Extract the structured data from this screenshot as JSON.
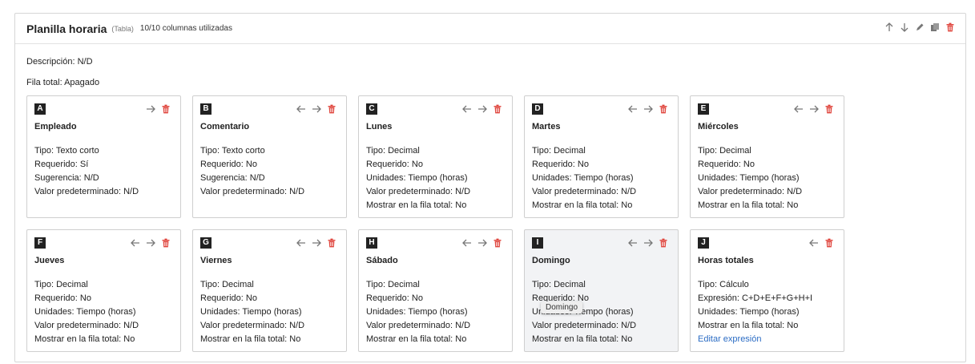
{
  "section": {
    "title": "Planilla horaria",
    "type": "(Tabla)",
    "usage": "10/10 columnas utilizadas",
    "description": "Descripción: N/D",
    "total_row": "Fila total: Apagado"
  },
  "cards": [
    {
      "letter": "A",
      "title": "Empleado",
      "lines": [
        "Tipo: Texto corto",
        "Requerido: Sí",
        "Sugerencia: N/D",
        "Valor predeterminado: N/D"
      ]
    },
    {
      "letter": "B",
      "title": "Comentario",
      "lines": [
        "Tipo: Texto corto",
        "Requerido: No",
        "Sugerencia: N/D",
        "Valor predeterminado: N/D"
      ]
    },
    {
      "letter": "C",
      "title": "Lunes",
      "lines": [
        "Tipo: Decimal",
        "Requerido: No",
        "Unidades: Tiempo (horas)",
        "Valor predeterminado: N/D",
        "Mostrar en la fila total: No"
      ]
    },
    {
      "letter": "D",
      "title": "Martes",
      "lines": [
        "Tipo: Decimal",
        "Requerido: No",
        "Unidades: Tiempo (horas)",
        "Valor predeterminado: N/D",
        "Mostrar en la fila total: No"
      ]
    },
    {
      "letter": "E",
      "title": "Miércoles",
      "lines": [
        "Tipo: Decimal",
        "Requerido: No",
        "Unidades: Tiempo (horas)",
        "Valor predeterminado: N/D",
        "Mostrar en la fila total: No"
      ]
    },
    {
      "letter": "F",
      "title": "Jueves",
      "lines": [
        "Tipo: Decimal",
        "Requerido: No",
        "Unidades: Tiempo (horas)",
        "Valor predeterminado: N/D",
        "Mostrar en la fila total: No"
      ]
    },
    {
      "letter": "G",
      "title": "Viernes",
      "lines": [
        "Tipo: Decimal",
        "Requerido: No",
        "Unidades: Tiempo (horas)",
        "Valor predeterminado: N/D",
        "Mostrar en la fila total: No"
      ]
    },
    {
      "letter": "H",
      "title": "Sábado",
      "lines": [
        "Tipo: Decimal",
        "Requerido: No",
        "Unidades: Tiempo (horas)",
        "Valor predeterminado: N/D",
        "Mostrar en la fila total: No"
      ]
    },
    {
      "letter": "I",
      "title": "Domingo",
      "lines": [
        "Tipo: Decimal",
        "Requerido: No",
        "Unidades: Tiempo (horas)",
        "Valor predeterminado: N/D",
        "Mostrar en la fila total: No"
      ]
    },
    {
      "letter": "J",
      "title": "Horas totales",
      "lines": [
        "Tipo: Cálculo",
        "Expresión: C+D+E+F+G+H+I",
        "Unidades: Tiempo (horas)",
        "Mostrar en la fila total: No"
      ],
      "link": "Editar expresión"
    }
  ],
  "tooltip": "Domingo",
  "colors": {
    "delete": "#e0463e",
    "icon": "#777777",
    "link": "#2b6cc4"
  },
  "icons": {
    "up": "arrow-up-icon",
    "down": "arrow-down-icon",
    "edit": "pencil-icon",
    "copy": "copy-icon",
    "delete": "trash-icon",
    "left": "arrow-left-icon",
    "right": "arrow-right-icon"
  }
}
